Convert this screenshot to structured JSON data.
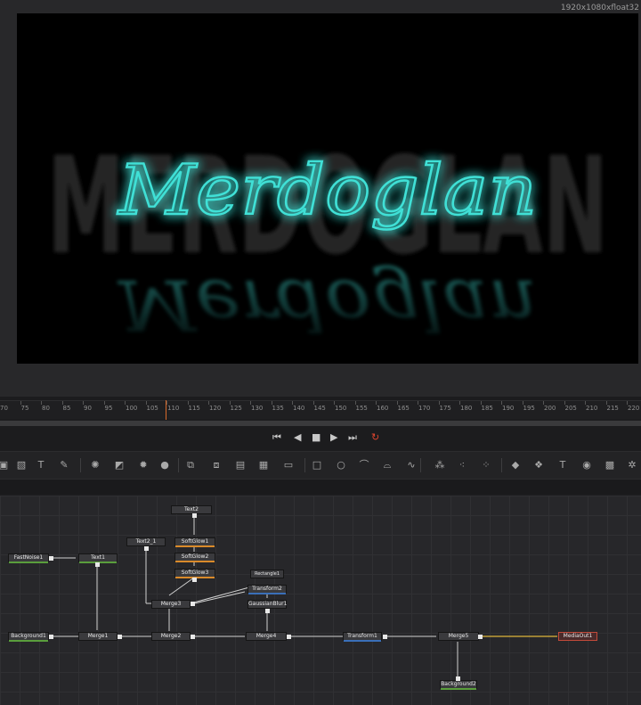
{
  "viewer": {
    "resolution_label": "1920x1080xfloat32",
    "canvas": {
      "bg_text": "MERDOGLAN",
      "neon_text": "Merdoglan",
      "neon_color": "#3fe0d6"
    }
  },
  "timeline": {
    "ticks": [
      "70",
      "75",
      "80",
      "85",
      "90",
      "95",
      "100",
      "105",
      "110",
      "115",
      "120",
      "125",
      "130",
      "135",
      "140",
      "145",
      "150",
      "155",
      "160",
      "165",
      "170",
      "175",
      "180",
      "185",
      "190",
      "195",
      "200",
      "205",
      "210",
      "215",
      "220"
    ],
    "current_frame": "110",
    "playhead_color": "#d86a2b"
  },
  "transport": {
    "buttons": [
      "skip-to-start",
      "play-reverse",
      "stop",
      "play-forward",
      "skip-to-end",
      "loop"
    ],
    "loop_color": "#e0452f"
  },
  "toolbar": {
    "icons": [
      "background-icon",
      "paint-icon",
      "text-icon",
      "brush-icon",
      "particles-icon",
      "color-corrector-icon",
      "brightness-icon",
      "blur-icon",
      "merge-icon",
      "merge-alt-icon",
      "loader-icon",
      "saver-icon",
      "transform-icon",
      "rectangle-mask-icon",
      "ellipse-mask-icon",
      "polygon-mask-icon",
      "bspline-mask-icon",
      "bitmap-mask-icon",
      "particle-emitter-icon",
      "particle-render-icon",
      "particle-style-icon",
      "shape3d-icon",
      "text3d-icon",
      "merge3d-icon",
      "camera3d-icon",
      "renderer3d-icon",
      "light-icon"
    ]
  },
  "nodes": {
    "text2": "Text2",
    "text2_1": "Text2_1",
    "softglow1": "SoftGlow1",
    "softglow2": "SoftGlow2",
    "softglow3": "SoftGlow3",
    "fastnoise1": "FastNoise1",
    "text1": "Text1",
    "rectangle1": "Rectangle1",
    "transform2": "Transform2",
    "merge3": "Merge3",
    "gaussianblur1": "GaussianBlur1",
    "background1": "Background1",
    "merge1": "Merge1",
    "merge2": "Merge2",
    "merge4": "Merge4",
    "transform1": "Transform1",
    "merge5": "Merge5",
    "mediaout1": "MediaOut1",
    "background2": "Background2"
  }
}
